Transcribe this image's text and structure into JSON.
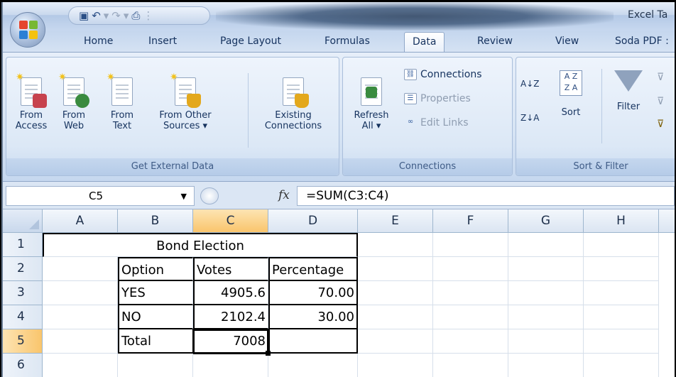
{
  "title_bar": {
    "title": "Excel Ta"
  },
  "tabs": [
    "Home",
    "Insert",
    "Page Layout",
    "Formulas",
    "Data",
    "Review",
    "View",
    "Soda PDF :"
  ],
  "active_tab": "Data",
  "ribbon": {
    "get_external_data": {
      "label": "Get External Data",
      "buttons": [
        {
          "line1": "From",
          "line2": "Access",
          "icon": "access-icon"
        },
        {
          "line1": "From",
          "line2": "Web",
          "icon": "web-icon"
        },
        {
          "line1": "From",
          "line2": "Text",
          "icon": "text-icon"
        },
        {
          "line1": "From Other",
          "line2": "Sources ▾",
          "icon": "database-icon"
        }
      ]
    },
    "existing": {
      "line1": "Existing",
      "line2": "Connections"
    },
    "connections": {
      "label": "Connections",
      "refresh_line1": "Refresh",
      "refresh_line2": "All ▾",
      "items": [
        "Connections",
        "Properties",
        "Edit Links"
      ]
    },
    "sort_filter": {
      "label": "Sort & Filter",
      "sort": "Sort",
      "filter": "Filter",
      "az": "A↓Z",
      "za": "Z↓A"
    }
  },
  "formula_bar": {
    "name_box": "C5",
    "fx": "fx",
    "formula": "=SUM(C3:C4)"
  },
  "columns": [
    "A",
    "B",
    "C",
    "D",
    "E",
    "F",
    "G",
    "H"
  ],
  "rows": [
    "1",
    "2",
    "3",
    "4",
    "5",
    "6"
  ],
  "cells": {
    "B1": "Bond Election",
    "B2": "Option",
    "C2": "Votes",
    "D2": "Percentage",
    "B3": "YES",
    "C3": "4905.6",
    "D3": "70.00",
    "B4": "NO",
    "C4": "2102.4",
    "D4": "30.00",
    "B5": "Total",
    "C5": "7008"
  },
  "colors": {
    "selected_header": "#f9c56c",
    "accent": "#15325e"
  }
}
